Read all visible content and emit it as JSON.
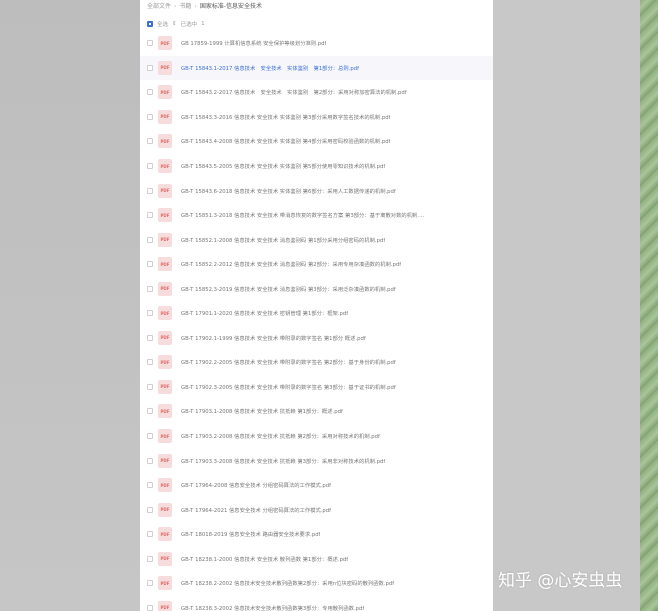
{
  "breadcrumb": {
    "root": "全部文件",
    "parent": "书籍",
    "current": "国家标准-信息安全技术"
  },
  "selection": {
    "all_label": "全选",
    "selected_label": "已选中",
    "selected_count": "1"
  },
  "files": [
    {
      "name": "GB 17859-1999 计算机信息系统 安全保护等级划分准则.pdf",
      "icon": "pdf-icon",
      "active": false
    },
    {
      "name": "GB-T 15843.1-2017 信息技术　安全技术　实体鉴别　第1部分：总则.pdf",
      "icon": "pdf-icon",
      "active": true
    },
    {
      "name": "GB-T 15843.2-2017 信息技术　安全技术　实体鉴别　第2部分：采用对称加密算法的机制.pdf",
      "icon": "pdf-icon",
      "active": false
    },
    {
      "name": "GB-T 15843.3-2016 信息技术 安全技术 实体鉴别 第3部分采用数字签名技术的机制.pdf",
      "icon": "pdf-icon",
      "active": false
    },
    {
      "name": "GB-T 15843.4-2008 信息技术 安全技术 实体鉴别 第4部分采用密码校验函数的机制.pdf",
      "icon": "pdf-icon",
      "active": false
    },
    {
      "name": "GB-T 15843.5-2005 信息技术 安全技术 实体鉴别 第5部分使用零知识技术的机制.pdf",
      "icon": "pdf-icon",
      "active": false
    },
    {
      "name": "GB-T 15843.6-2018 信息技术 安全技术 实体鉴别 第6部分：采用人工数据传递的机制.pdf",
      "icon": "pdf-icon",
      "active": false
    },
    {
      "name": "GB-T 15851.3-2018 信息技术 安全技术 带消息恢复的数字签名方案 第3部分：基于离散对数的机制....",
      "icon": "pdf-icon",
      "active": false
    },
    {
      "name": "GB-T 15852.1-2008 信息技术 安全技术 消息鉴别码 第1部分采用分组密码的机制.pdf",
      "icon": "pdf-icon",
      "active": false
    },
    {
      "name": "GB-T 15852.2-2012 信息技术 安全技术 消息鉴别码 第2部分：采用专用杂凑函数的机制.pdf",
      "icon": "pdf-icon",
      "active": false
    },
    {
      "name": "GB-T 15852.3-2019 信息技术 安全技术 消息鉴别码 第3部分：采用泛杂凑函数的机制.pdf",
      "icon": "pdf-icon",
      "active": false
    },
    {
      "name": "GB-T 17901.1-2020 信息技术 安全技术 密钥管理 第1部分：框架.pdf",
      "icon": "pdf-icon",
      "active": false
    },
    {
      "name": "GB-T 17902.1-1999 信息技术 安全技术 带附录的数字签名 第1部分 概述.pdf",
      "icon": "pdf-icon",
      "active": false
    },
    {
      "name": "GB-T 17902.2-2005 信息技术 安全技术 带附录的数字签名 第2部分：基于身份的机制.pdf",
      "icon": "pdf-icon",
      "active": false
    },
    {
      "name": "GB-T 17902.3-2005 信息技术 安全技术 带附录的数字签名 第3部分：基于证书的机制.pdf",
      "icon": "pdf-icon",
      "active": false
    },
    {
      "name": "GB-T 17903.1-2008 信息技术 安全技术 抗抵赖 第1部分：概述.pdf",
      "icon": "pdf-icon",
      "active": false
    },
    {
      "name": "GB-T 17903.2-2008 信息技术 安全技术 抗抵赖 第2部分：采用对称技术的机制.pdf",
      "icon": "pdf-icon",
      "active": false
    },
    {
      "name": "GB-T 17903.3-2008 信息技术 安全技术 抗抵赖 第3部分：采用非对称技术的机制.pdf",
      "icon": "pdf-icon",
      "active": false
    },
    {
      "name": "GB-T 17964-2008 信息安全技术 分组密码算法的工作模式.pdf",
      "icon": "pdf-icon",
      "active": false
    },
    {
      "name": "GB-T 17964-2021 信息安全技术 分组密码算法的工作模式.pdf",
      "icon": "pdf-icon",
      "active": false
    },
    {
      "name": "GB-T 18018-2019 信息安全技术 路由器安全技术要求.pdf",
      "icon": "pdf-icon",
      "active": false
    },
    {
      "name": "GB-T 18238.1-2000 信息技术 安全技术 散列函数 第1部分：概述.pdf",
      "icon": "pdf-icon",
      "active": false
    },
    {
      "name": "GB-T 18238.2-2002 信息技术安全技术散列函数第2部分：采用n位块密码的散列函数.pdf",
      "icon": "pdf-icon",
      "active": false
    },
    {
      "name": "GB-T 18238.3-2002 信息技术安全技术散列函数第3部分：专用散列函数.pdf",
      "icon": "pdf-icon",
      "active": false
    }
  ],
  "pdf_badge": "PDF",
  "watermark": "知乎 @心安虫虫",
  "colors": {
    "accent": "#3a6fd8",
    "pdf_icon_bg": "#f6dcdc",
    "pdf_icon_fg": "#e06a6a"
  }
}
